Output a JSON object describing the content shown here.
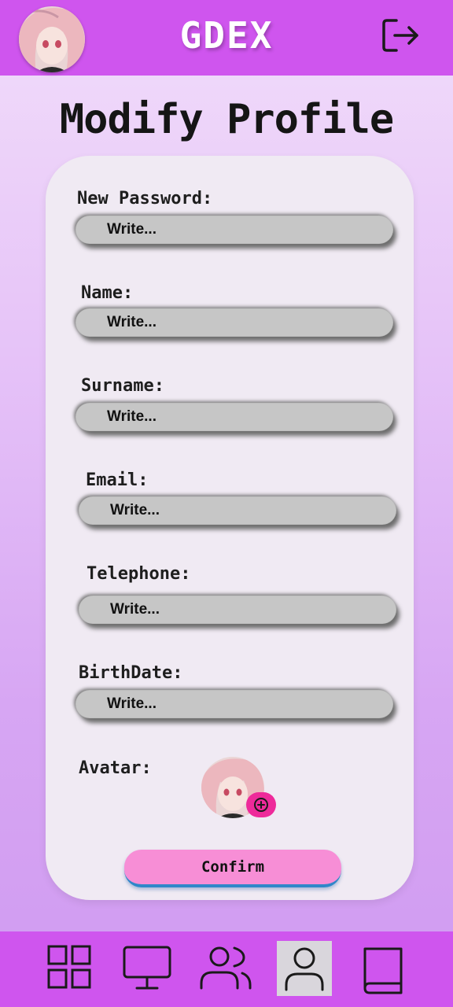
{
  "header": {
    "logo": "GDEX",
    "avatar_icon": "user-avatar-image",
    "logout_icon": "logout-icon"
  },
  "page": {
    "title": "Modify Profile"
  },
  "form": {
    "fields": [
      {
        "label": "New Password:",
        "placeholder": "Write..."
      },
      {
        "label": "Name:",
        "placeholder": "Write..."
      },
      {
        "label": "Surname:",
        "placeholder": "Write..."
      },
      {
        "label": "Email:",
        "placeholder": "Write..."
      },
      {
        "label": "Telephone:",
        "placeholder": "Write..."
      },
      {
        "label": "BirthDate:",
        "placeholder": "Write..."
      }
    ],
    "avatar_label": "Avatar:",
    "confirm_label": "Confirm"
  },
  "nav": {
    "items": [
      {
        "icon": "grid-icon"
      },
      {
        "icon": "monitor-icon"
      },
      {
        "icon": "users-icon"
      },
      {
        "icon": "user-icon",
        "active": true
      },
      {
        "icon": "book-icon"
      }
    ]
  },
  "colors": {
    "header_bg": "#cf55ee",
    "card_bg": "#f0eaf3",
    "field_bg": "#c6c6c6",
    "confirm_bg": "#f78ed6",
    "badge_bg": "#ee2a9a"
  }
}
